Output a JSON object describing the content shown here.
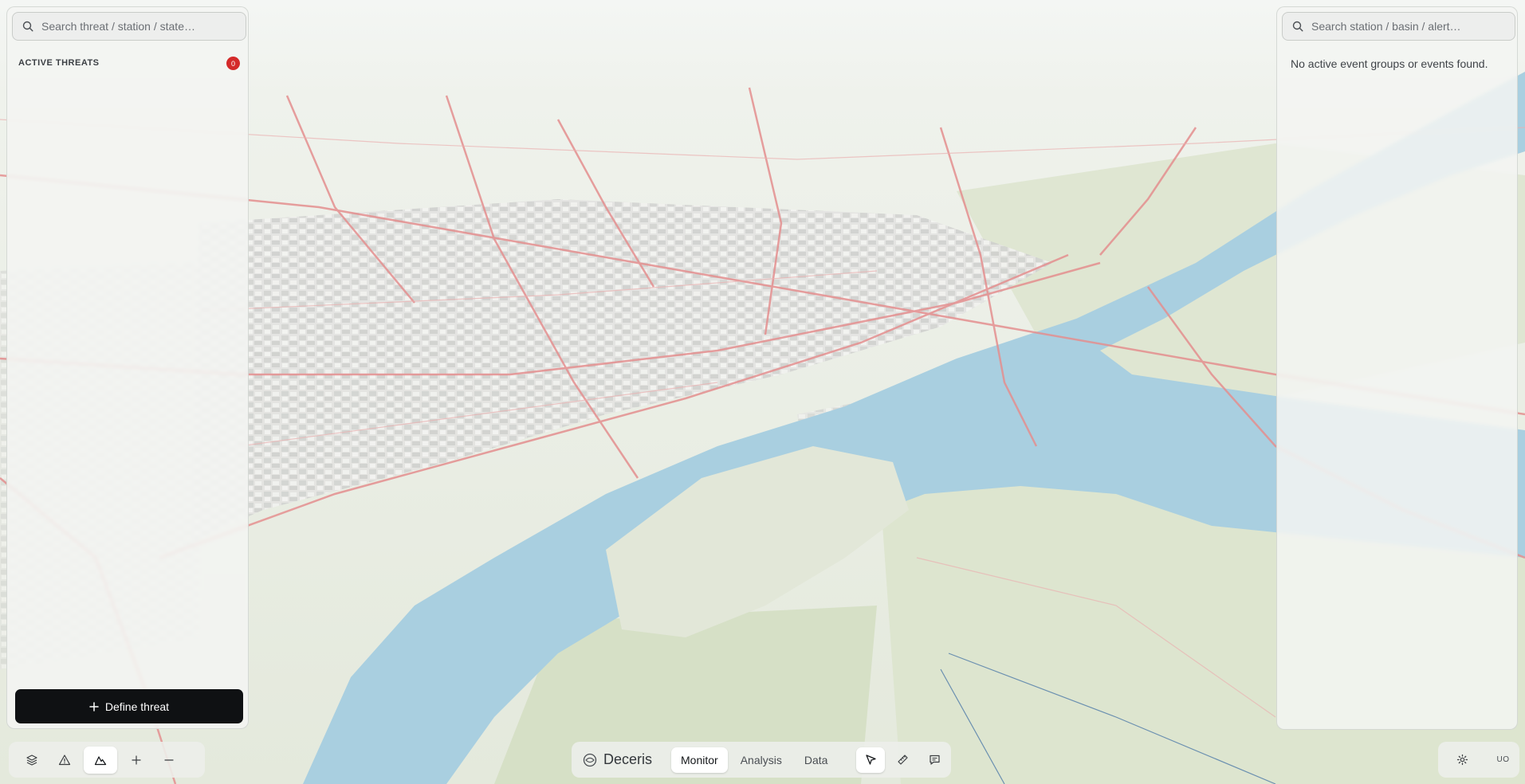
{
  "left_panel": {
    "search_placeholder": "Search threat / station / state…",
    "section_title": "ACTIVE THREATS",
    "active_threat_count": "0",
    "define_threat_label": "Define threat"
  },
  "right_panel": {
    "search_placeholder": "Search station / basin / alert…",
    "empty_message": "No active event groups or events found."
  },
  "left_toolbar": {
    "buttons": [
      {
        "icon": "layers-icon",
        "active": false
      },
      {
        "icon": "warning-icon",
        "active": false
      },
      {
        "icon": "mountain-icon",
        "active": true
      },
      {
        "icon": "zoom-in-icon",
        "active": false
      },
      {
        "icon": "zoom-out-icon",
        "active": false
      }
    ]
  },
  "center_toolbar": {
    "app_name": "Deceris",
    "tabs": [
      "Monitor",
      "Analysis",
      "Data"
    ],
    "active_tab": "Monitor",
    "tools": [
      "cursor-icon",
      "ruler-icon",
      "comment-icon"
    ]
  },
  "right_toolbar": {
    "user_initials": "UO",
    "settings_icon": "gear-icon"
  },
  "colors": {
    "water": "#a9cfe0",
    "land": "#e4e9dc",
    "roads": "#e48f8f",
    "badge": "#d42a2a",
    "primary_button": "#0f1113"
  }
}
